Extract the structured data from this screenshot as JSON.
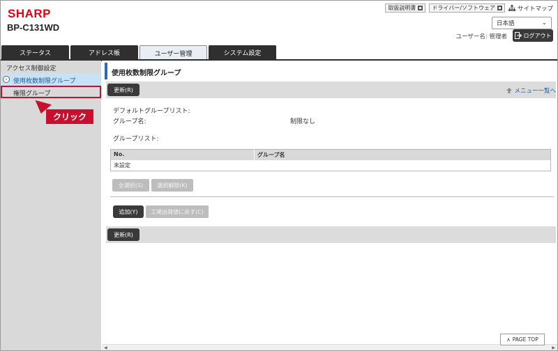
{
  "header": {
    "brand": "SHARP",
    "model": "BP-C131WD",
    "links": [
      "取扱説明書",
      "ドライバー/ソフトウェア"
    ],
    "sitemap": "サイトマップ",
    "language": "日本語",
    "user_label": "ユーザー名: 管理者",
    "logout": "ログアウト"
  },
  "tabs": [
    {
      "label": "ステータス",
      "active": false
    },
    {
      "label": "アドレス帳",
      "active": false
    },
    {
      "label": "ユーザー管理",
      "active": true
    },
    {
      "label": "システム設定",
      "active": false
    }
  ],
  "sidebar": {
    "heading": "アクセス制御設定",
    "items": [
      {
        "label": "使用枚数制限グループ",
        "active": true
      },
      {
        "label": "権限グループ",
        "active": false
      }
    ],
    "callout": "クリック"
  },
  "main": {
    "title": "使用枚数制限グループ",
    "update_button": "更新(R)",
    "menu_link": "メニュー一覧へ",
    "default_group_list": "デフォルトグループリスト:",
    "group_name_label": "グループ名:",
    "group_name_value": "制限なし",
    "group_list": "グループリスト:",
    "table": {
      "headers": [
        "No.",
        "グループ名"
      ],
      "rows": [
        [
          "未設定",
          ""
        ]
      ]
    },
    "select_all": "全選択(S)",
    "deselect": "選択解除(K)",
    "add": "追加(Y)",
    "reset_factory": "工場出荷値に戻す(C)",
    "update_button_bottom": "更新(R)"
  },
  "page_top": "PAGE TOP",
  "colors": {
    "brand": "#e50012",
    "dark": "#3a3a3a",
    "accent_blue": "#2b6cb0",
    "highlight": "#c8102e"
  }
}
